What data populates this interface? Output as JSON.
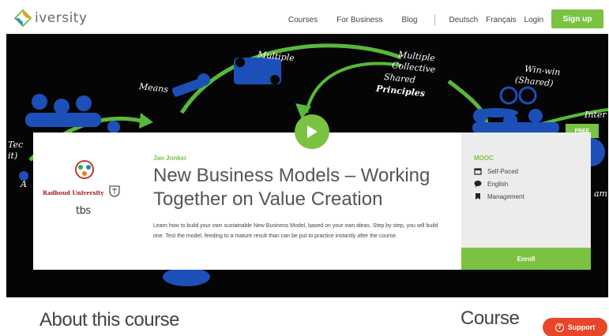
{
  "header": {
    "logo_text": "iversity",
    "nav": {
      "courses": "Courses",
      "business": "For Business",
      "blog": "Blog",
      "lang_de": "Deutsch",
      "lang_fr": "Français",
      "login": "Login"
    },
    "signup": "Sign up"
  },
  "hero": {
    "words": {
      "means": "Means",
      "multiple": "Multiple",
      "multiple_collective": "Multiple",
      "collective": "Collective",
      "shared": "Shared",
      "principles": "Principles",
      "winwin": "Win-win",
      "winwin_shared": "(Shared)",
      "left_tec": "Tec",
      "left_it": "it)",
      "left_a": "A",
      "inter": "Inter",
      "am": "am"
    },
    "free_badge": "FREE"
  },
  "course": {
    "university": "Radboud University",
    "tbs": "tbs",
    "instructor": "Jan Jonker",
    "title": "New Business Models – Working Together on Value Creation",
    "description": "Learn how to build your own sustainable New Business Model, based on your own ideas. Step by step, you will build one. Test the model, feeding to a mature result than can be put to practice instantly after the course.",
    "type": "MOOC",
    "meta": {
      "pace": "Self-Paced",
      "language": "English",
      "category": "Management"
    },
    "enroll": "Enroll"
  },
  "below": {
    "about": "About this course",
    "course": "Course",
    "support": "Support"
  },
  "colors": {
    "accent": "#7cc242",
    "support": "#e8462a"
  }
}
